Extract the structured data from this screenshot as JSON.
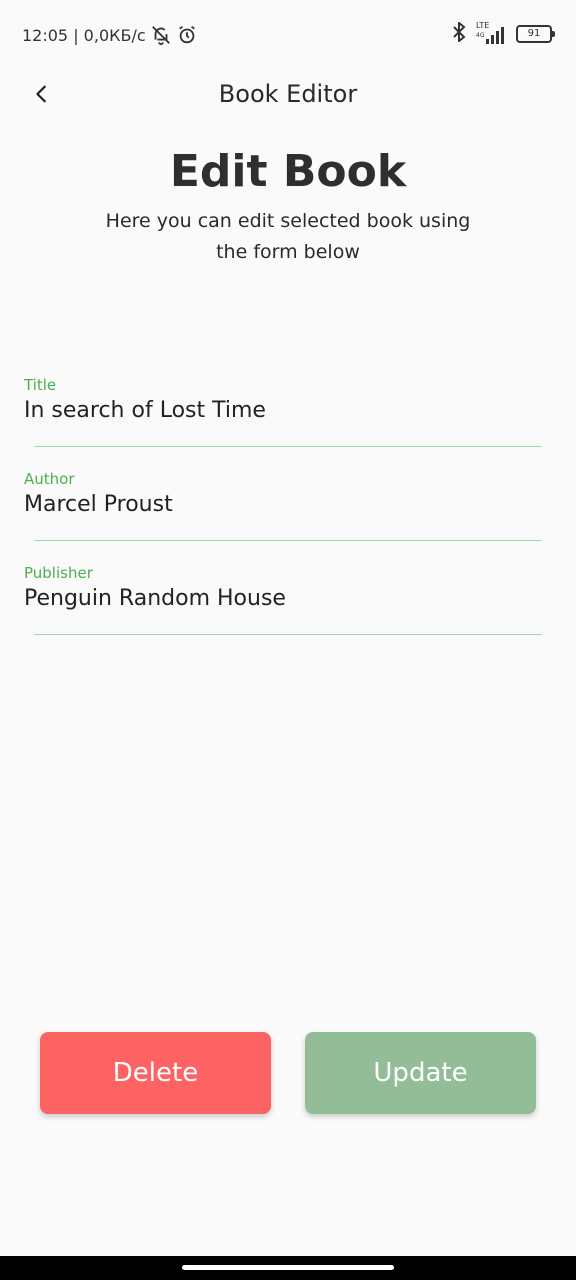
{
  "status_bar": {
    "time_and_speed": "12:05 | 0,0КБ/с",
    "network_label": "LTE",
    "network_sub": "4G",
    "battery": "91"
  },
  "app_bar": {
    "title": "Book Editor"
  },
  "header": {
    "heading": "Edit Book",
    "subtitle": "Here you can edit selected book using the form below"
  },
  "form": {
    "title": {
      "label": "Title",
      "value": "In search of Lost Time"
    },
    "author": {
      "label": "Author",
      "value": "Marcel Proust"
    },
    "publisher": {
      "label": "Publisher",
      "value": "Penguin Random House"
    }
  },
  "actions": {
    "delete_label": "Delete",
    "update_label": "Update"
  },
  "colors": {
    "accent": "#4caf50",
    "delete": "#fe6363",
    "update": "#93bd97"
  }
}
